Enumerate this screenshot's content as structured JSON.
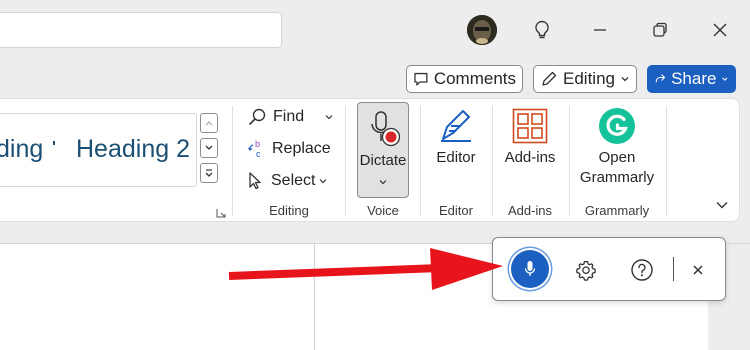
{
  "titlebar": {
    "avatar_icon": "user-avatar",
    "ideas_icon": "lightbulb-icon",
    "minimize_icon": "minimize-icon",
    "restore_icon": "restore-icon",
    "close_icon": "close-icon"
  },
  "top_actions": {
    "comments_label": "Comments",
    "editing_label": "Editing",
    "share_label": "Share",
    "share_color": "#1b5fc1"
  },
  "styles": {
    "item_partial_label": "ding",
    "heading2_label": "Heading 2",
    "heading_color": "#1c4f74"
  },
  "editing_group": {
    "find_label": "Find",
    "replace_label": "Replace",
    "select_label": "Select",
    "group_label": "Editing"
  },
  "voice_group": {
    "dictate_label": "Dictate",
    "group_label": "Voice"
  },
  "editor_group": {
    "editor_label": "Editor",
    "group_label": "Editor"
  },
  "addins_group": {
    "addins_label": "Add-ins",
    "group_label": "Add-ins"
  },
  "grammarly_group": {
    "open_label_line1": "Open",
    "open_label_line2": "Grammarly",
    "group_label": "Grammarly",
    "brand_color": "#15c39a"
  },
  "dictation_toolbar": {
    "mic_icon": "microphone-icon",
    "settings_icon": "gear-icon",
    "help_icon": "help-icon",
    "close_icon": "close-icon",
    "active_color": "#1b5fc1"
  },
  "annotation": {
    "arrow_color": "#e8141b"
  }
}
